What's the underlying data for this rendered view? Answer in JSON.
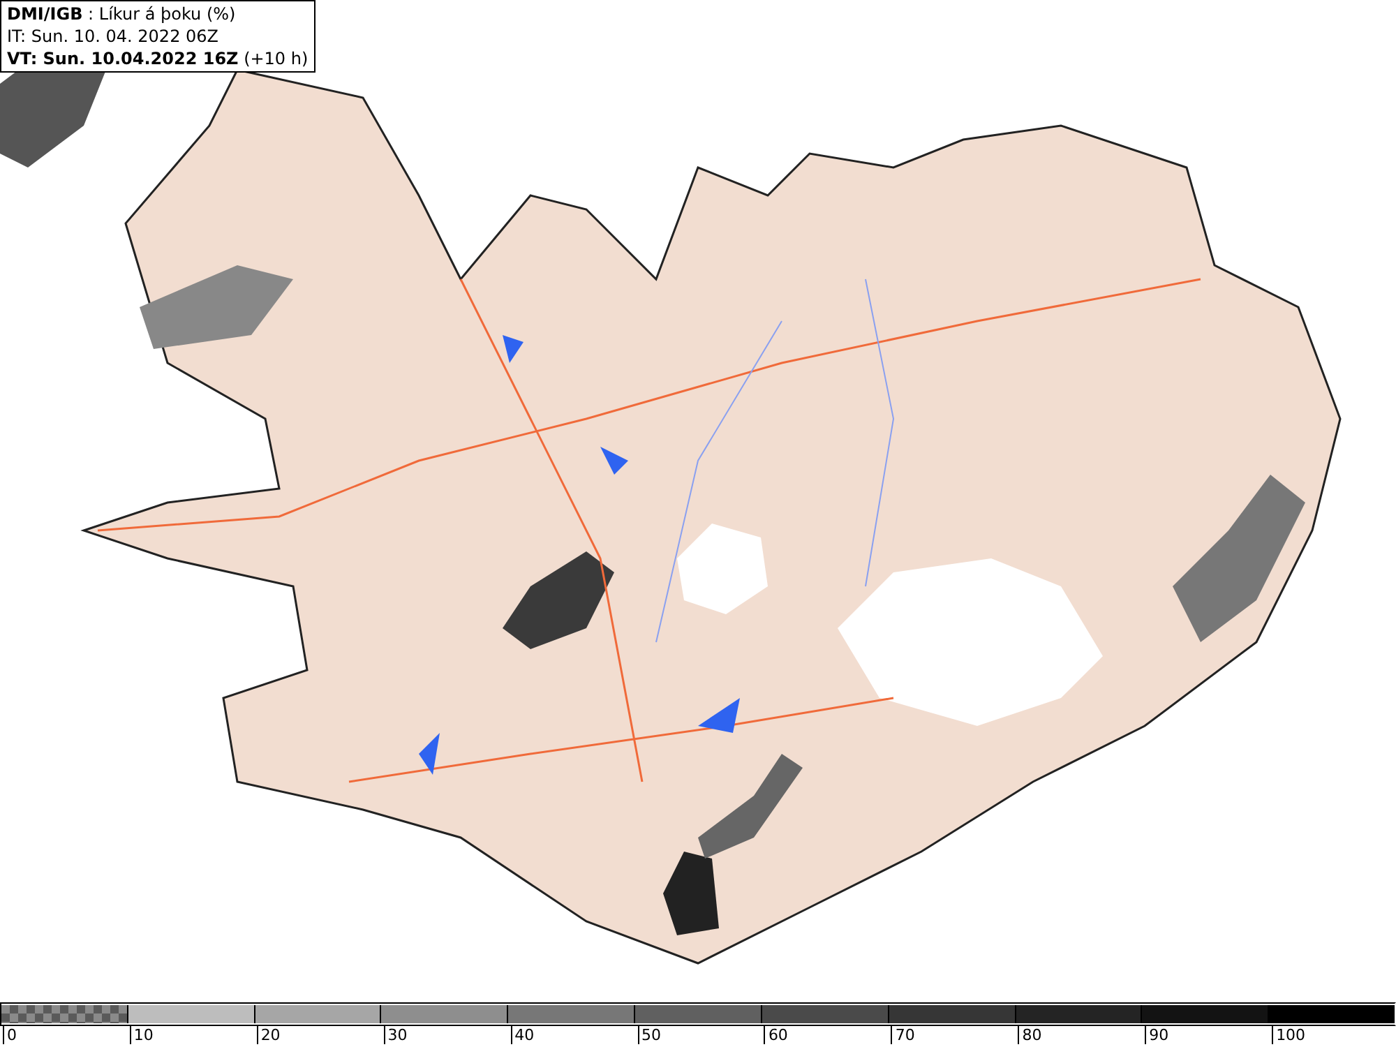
{
  "header": {
    "lines": [
      "**DMI/IGB** : Líkur á þoku (%)",
      "IT: Sun. 10. 04. 2022 06Z",
      "**VT: Sun. 10.04.2022 16Z** (+10 h)"
    ]
  },
  "legend": {
    "segments": [
      {
        "kind": "checker",
        "color": "#8a8a8a"
      },
      {
        "kind": "solid",
        "color": "#bdbdbd"
      },
      {
        "kind": "solid",
        "color": "#a6a6a6"
      },
      {
        "kind": "solid",
        "color": "#8e8e8e"
      },
      {
        "kind": "solid",
        "color": "#777777"
      },
      {
        "kind": "solid",
        "color": "#606060"
      },
      {
        "kind": "solid",
        "color": "#4a4a4a"
      },
      {
        "kind": "solid",
        "color": "#363636"
      },
      {
        "kind": "solid",
        "color": "#242424"
      },
      {
        "kind": "solid",
        "color": "#131313"
      },
      {
        "kind": "solid",
        "color": "#000000"
      }
    ],
    "ticks": [
      "0",
      "10",
      "20",
      "30",
      "40",
      "50",
      "60",
      "70",
      "80",
      "90",
      "100"
    ]
  }
}
